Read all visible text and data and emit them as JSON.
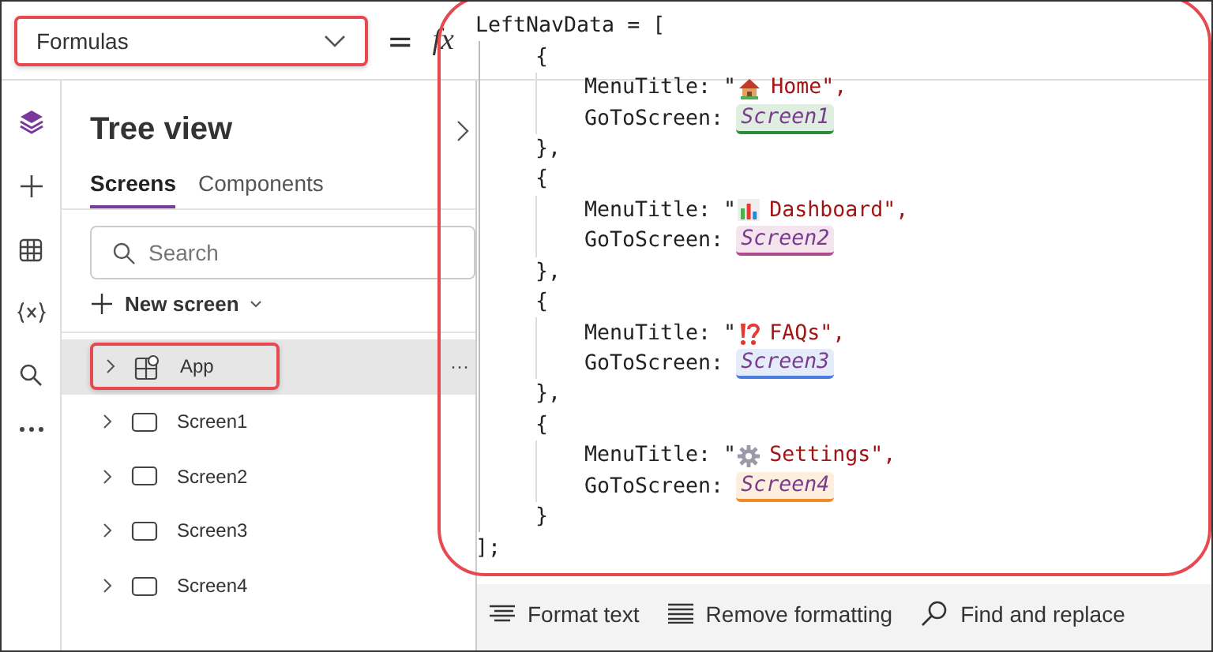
{
  "formula_bar": {
    "property": "Formulas",
    "equals": "=",
    "fx": "fx"
  },
  "tree_view": {
    "title": "Tree view",
    "tabs": [
      {
        "label": "Screens",
        "selected": true
      },
      {
        "label": "Components",
        "selected": false
      }
    ],
    "search": {
      "placeholder": "Search"
    },
    "new_screen": "New screen",
    "items": [
      {
        "label": "App",
        "kind": "app",
        "selected": true,
        "more": "···"
      },
      {
        "label": "Screen1",
        "kind": "screen",
        "selected": false
      },
      {
        "label": "Screen2",
        "kind": "screen",
        "selected": false
      },
      {
        "label": "Screen3",
        "kind": "screen",
        "selected": false
      },
      {
        "label": "Screen4",
        "kind": "screen",
        "selected": false
      }
    ]
  },
  "code": {
    "head": "LeftNavData = [",
    "close": "];",
    "entries": [
      {
        "open": "{",
        "title_key": "MenuTitle: \"",
        "title": "Home\",",
        "screen_key": "GoToScreen:",
        "screen": "Screen1",
        "color": "#2e8b3e",
        "end": "},"
      },
      {
        "open": "{",
        "title_key": "MenuTitle: \"",
        "title": "Dashboard\",",
        "screen_key": "GoToScreen:",
        "screen": "Screen2",
        "color": "#b04a8c",
        "end": "},"
      },
      {
        "open": "{",
        "title_key": "MenuTitle: \"",
        "title": "FAQs\",",
        "screen_key": "GoToScreen:",
        "screen": "Screen3",
        "color": "#4a7de0",
        "end": "},"
      },
      {
        "open": "{",
        "title_key": "MenuTitle: \"",
        "title": "Settings\",",
        "screen_key": "GoToScreen:",
        "screen": "Screen4",
        "color": "#f08a24",
        "end": "}"
      }
    ]
  },
  "toolbar": [
    "Format text",
    "Remove formatting",
    "Find and replace"
  ]
}
